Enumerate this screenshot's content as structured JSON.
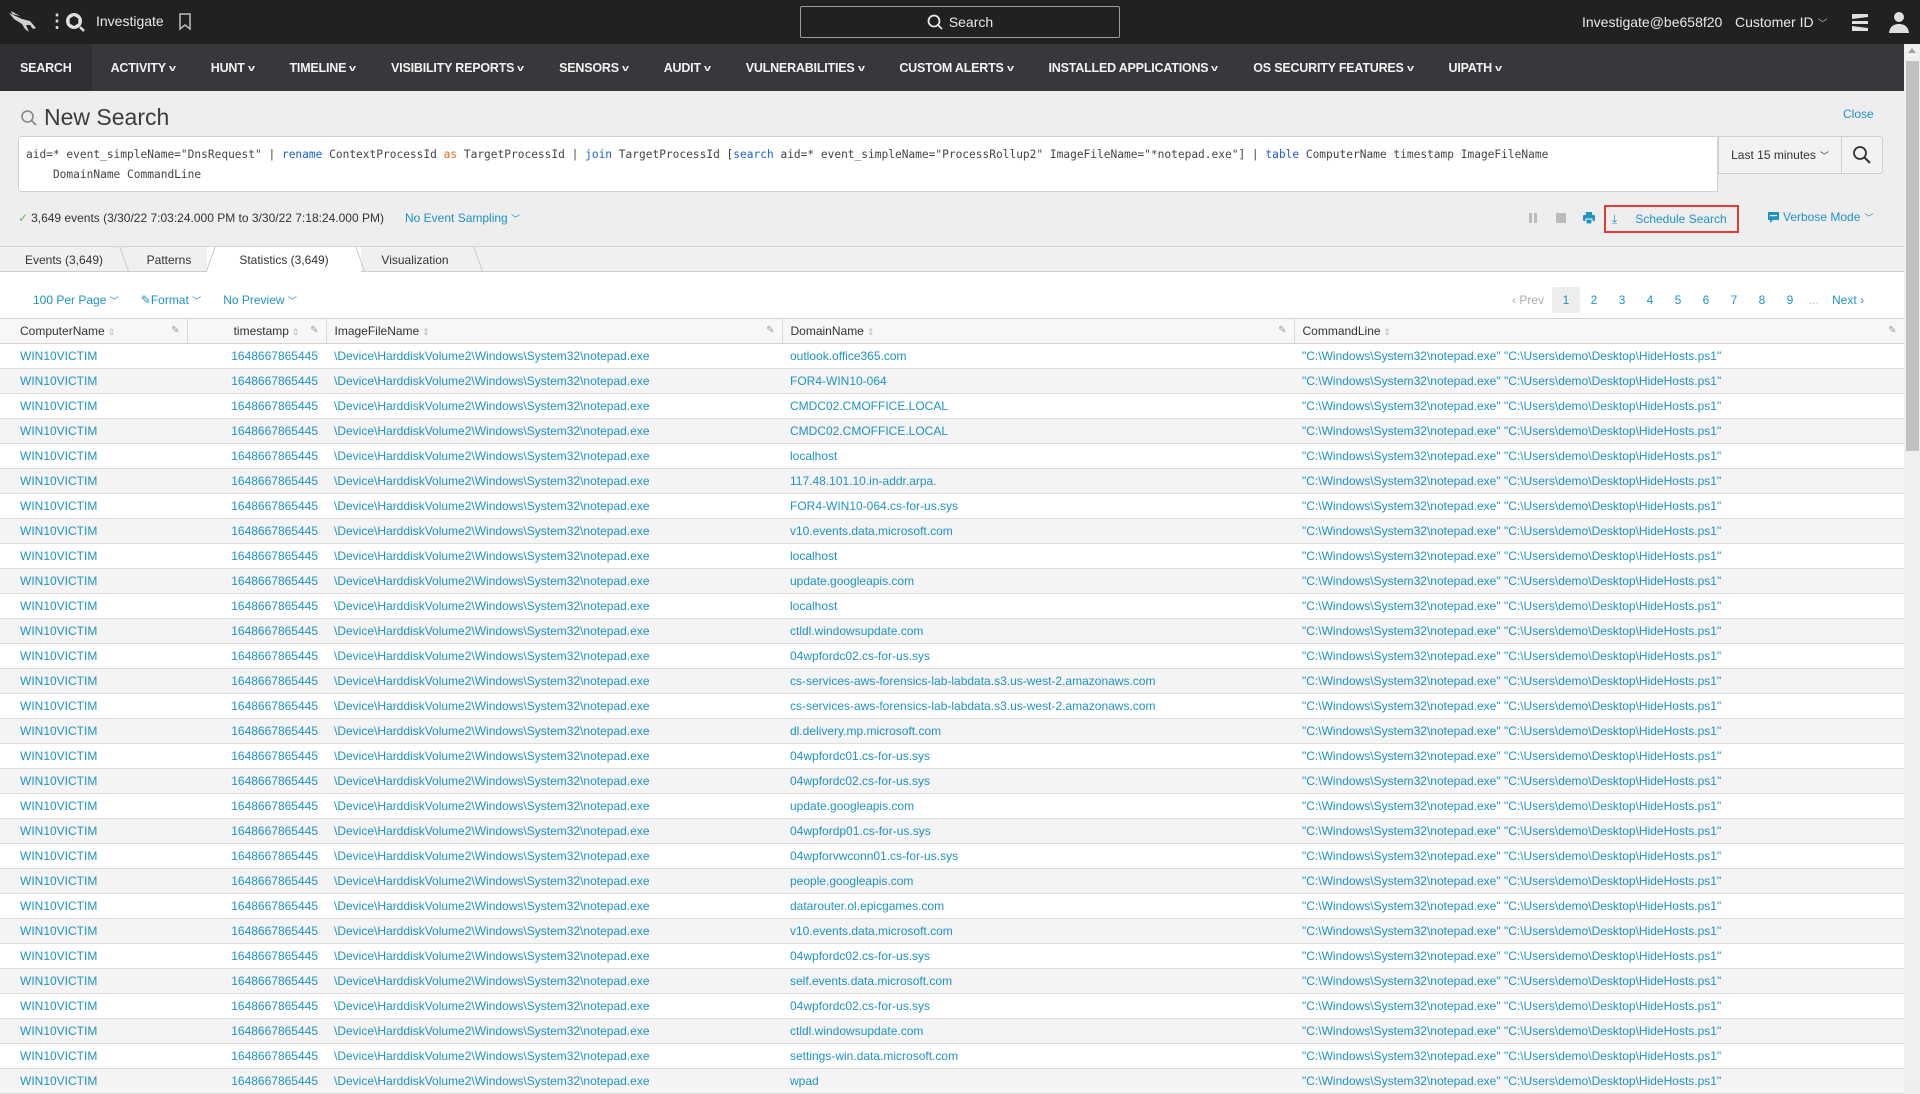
{
  "topbar": {
    "app_title": "Investigate",
    "global_search_label": "Search",
    "user_label": "Investigate@be658f20",
    "customer_id_label": "Customer ID"
  },
  "nav": {
    "items": [
      {
        "label": "SEARCH",
        "dropdown": false,
        "active": true
      },
      {
        "label": "ACTIVITY",
        "dropdown": true
      },
      {
        "label": "HUNT",
        "dropdown": true
      },
      {
        "label": "TIMELINE",
        "dropdown": true
      },
      {
        "label": "VISIBILITY REPORTS",
        "dropdown": true
      },
      {
        "label": "SENSORS",
        "dropdown": true
      },
      {
        "label": "AUDIT",
        "dropdown": true
      },
      {
        "label": "VULNERABILITIES",
        "dropdown": true
      },
      {
        "label": "CUSTOM ALERTS",
        "dropdown": true
      },
      {
        "label": "INSTALLED APPLICATIONS",
        "dropdown": true
      },
      {
        "label": "OS SECURITY FEATURES",
        "dropdown": true
      },
      {
        "label": "UIPATH",
        "dropdown": true
      }
    ]
  },
  "search": {
    "page_title": "New Search",
    "close_label": "Close",
    "query_line1_parts": [
      {
        "t": "aid=* event_simpleName=\"DnsRequest\" | ",
        "c": ""
      },
      {
        "t": "rename",
        "c": "blue"
      },
      {
        "t": " ContextProcessId ",
        "c": ""
      },
      {
        "t": "as",
        "c": "orange"
      },
      {
        "t": " TargetProcessId | ",
        "c": ""
      },
      {
        "t": "join",
        "c": "blue"
      },
      {
        "t": " TargetProcessId [",
        "c": ""
      },
      {
        "t": "search",
        "c": "blue"
      },
      {
        "t": " aid=* event_simpleName=\"ProcessRollup2\" ImageFileName=\"*notepad.exe\"] | ",
        "c": ""
      },
      {
        "t": "table",
        "c": "blue"
      },
      {
        "t": " ComputerName timestamp ImageFileName",
        "c": ""
      }
    ],
    "query_line2": "    DomainName CommandLine",
    "time_range": "Last 15 minutes"
  },
  "status": {
    "check": "✓",
    "summary": "3,649 events (3/30/22 7:03:24.000 PM to 3/30/22 7:18:24.000 PM)",
    "sampling": "No Event Sampling",
    "schedule_search": "Schedule Search",
    "mode": "Verbose Mode"
  },
  "tabs": [
    {
      "label": "Events (3,649)",
      "active": false
    },
    {
      "label": "Patterns",
      "active": false
    },
    {
      "label": "Statistics (3,649)",
      "active": true
    },
    {
      "label": "Visualization",
      "active": false
    }
  ],
  "table_controls": {
    "per_page": "100 Per Page",
    "format": "Format",
    "preview": "No Preview"
  },
  "pagination": {
    "prev": "‹ Prev",
    "pages": [
      "1",
      "2",
      "3",
      "4",
      "5",
      "6",
      "7",
      "8",
      "9"
    ],
    "current": "1",
    "ellipsis": "...",
    "next": "Next ›"
  },
  "table": {
    "columns": [
      "ComputerName",
      "timestamp",
      "ImageFileName",
      "DomainName",
      "CommandLine"
    ],
    "rows": [
      [
        "WIN10VICTIM",
        "1648667865445",
        "\\Device\\HarddiskVolume2\\Windows\\System32\\notepad.exe",
        "outlook.office365.com",
        "\"C:\\Windows\\System32\\notepad.exe\" \"C:\\Users\\demo\\Desktop\\HideHosts.ps1\""
      ],
      [
        "WIN10VICTIM",
        "1648667865445",
        "\\Device\\HarddiskVolume2\\Windows\\System32\\notepad.exe",
        "FOR4-WIN10-064",
        "\"C:\\Windows\\System32\\notepad.exe\" \"C:\\Users\\demo\\Desktop\\HideHosts.ps1\""
      ],
      [
        "WIN10VICTIM",
        "1648667865445",
        "\\Device\\HarddiskVolume2\\Windows\\System32\\notepad.exe",
        "CMDC02.CMOFFICE.LOCAL",
        "\"C:\\Windows\\System32\\notepad.exe\" \"C:\\Users\\demo\\Desktop\\HideHosts.ps1\""
      ],
      [
        "WIN10VICTIM",
        "1648667865445",
        "\\Device\\HarddiskVolume2\\Windows\\System32\\notepad.exe",
        "CMDC02.CMOFFICE.LOCAL",
        "\"C:\\Windows\\System32\\notepad.exe\" \"C:\\Users\\demo\\Desktop\\HideHosts.ps1\""
      ],
      [
        "WIN10VICTIM",
        "1648667865445",
        "\\Device\\HarddiskVolume2\\Windows\\System32\\notepad.exe",
        "localhost",
        "\"C:\\Windows\\System32\\notepad.exe\" \"C:\\Users\\demo\\Desktop\\HideHosts.ps1\""
      ],
      [
        "WIN10VICTIM",
        "1648667865445",
        "\\Device\\HarddiskVolume2\\Windows\\System32\\notepad.exe",
        "117.48.101.10.in-addr.arpa.",
        "\"C:\\Windows\\System32\\notepad.exe\" \"C:\\Users\\demo\\Desktop\\HideHosts.ps1\""
      ],
      [
        "WIN10VICTIM",
        "1648667865445",
        "\\Device\\HarddiskVolume2\\Windows\\System32\\notepad.exe",
        "FOR4-WIN10-064.cs-for-us.sys",
        "\"C:\\Windows\\System32\\notepad.exe\" \"C:\\Users\\demo\\Desktop\\HideHosts.ps1\""
      ],
      [
        "WIN10VICTIM",
        "1648667865445",
        "\\Device\\HarddiskVolume2\\Windows\\System32\\notepad.exe",
        "v10.events.data.microsoft.com",
        "\"C:\\Windows\\System32\\notepad.exe\" \"C:\\Users\\demo\\Desktop\\HideHosts.ps1\""
      ],
      [
        "WIN10VICTIM",
        "1648667865445",
        "\\Device\\HarddiskVolume2\\Windows\\System32\\notepad.exe",
        "localhost",
        "\"C:\\Windows\\System32\\notepad.exe\" \"C:\\Users\\demo\\Desktop\\HideHosts.ps1\""
      ],
      [
        "WIN10VICTIM",
        "1648667865445",
        "\\Device\\HarddiskVolume2\\Windows\\System32\\notepad.exe",
        "update.googleapis.com",
        "\"C:\\Windows\\System32\\notepad.exe\" \"C:\\Users\\demo\\Desktop\\HideHosts.ps1\""
      ],
      [
        "WIN10VICTIM",
        "1648667865445",
        "\\Device\\HarddiskVolume2\\Windows\\System32\\notepad.exe",
        "localhost",
        "\"C:\\Windows\\System32\\notepad.exe\" \"C:\\Users\\demo\\Desktop\\HideHosts.ps1\""
      ],
      [
        "WIN10VICTIM",
        "1648667865445",
        "\\Device\\HarddiskVolume2\\Windows\\System32\\notepad.exe",
        "ctldl.windowsupdate.com",
        "\"C:\\Windows\\System32\\notepad.exe\" \"C:\\Users\\demo\\Desktop\\HideHosts.ps1\""
      ],
      [
        "WIN10VICTIM",
        "1648667865445",
        "\\Device\\HarddiskVolume2\\Windows\\System32\\notepad.exe",
        "04wpfordc02.cs-for-us.sys",
        "\"C:\\Windows\\System32\\notepad.exe\" \"C:\\Users\\demo\\Desktop\\HideHosts.ps1\""
      ],
      [
        "WIN10VICTIM",
        "1648667865445",
        "\\Device\\HarddiskVolume2\\Windows\\System32\\notepad.exe",
        "cs-services-aws-forensics-lab-labdata.s3.us-west-2.amazonaws.com",
        "\"C:\\Windows\\System32\\notepad.exe\" \"C:\\Users\\demo\\Desktop\\HideHosts.ps1\""
      ],
      [
        "WIN10VICTIM",
        "1648667865445",
        "\\Device\\HarddiskVolume2\\Windows\\System32\\notepad.exe",
        "cs-services-aws-forensics-lab-labdata.s3.us-west-2.amazonaws.com",
        "\"C:\\Windows\\System32\\notepad.exe\" \"C:\\Users\\demo\\Desktop\\HideHosts.ps1\""
      ],
      [
        "WIN10VICTIM",
        "1648667865445",
        "\\Device\\HarddiskVolume2\\Windows\\System32\\notepad.exe",
        "dl.delivery.mp.microsoft.com",
        "\"C:\\Windows\\System32\\notepad.exe\" \"C:\\Users\\demo\\Desktop\\HideHosts.ps1\""
      ],
      [
        "WIN10VICTIM",
        "1648667865445",
        "\\Device\\HarddiskVolume2\\Windows\\System32\\notepad.exe",
        "04wpfordc01.cs-for-us.sys",
        "\"C:\\Windows\\System32\\notepad.exe\" \"C:\\Users\\demo\\Desktop\\HideHosts.ps1\""
      ],
      [
        "WIN10VICTIM",
        "1648667865445",
        "\\Device\\HarddiskVolume2\\Windows\\System32\\notepad.exe",
        "04wpfordc02.cs-for-us.sys",
        "\"C:\\Windows\\System32\\notepad.exe\" \"C:\\Users\\demo\\Desktop\\HideHosts.ps1\""
      ],
      [
        "WIN10VICTIM",
        "1648667865445",
        "\\Device\\HarddiskVolume2\\Windows\\System32\\notepad.exe",
        "update.googleapis.com",
        "\"C:\\Windows\\System32\\notepad.exe\" \"C:\\Users\\demo\\Desktop\\HideHosts.ps1\""
      ],
      [
        "WIN10VICTIM",
        "1648667865445",
        "\\Device\\HarddiskVolume2\\Windows\\System32\\notepad.exe",
        "04wpfordp01.cs-for-us.sys",
        "\"C:\\Windows\\System32\\notepad.exe\" \"C:\\Users\\demo\\Desktop\\HideHosts.ps1\""
      ],
      [
        "WIN10VICTIM",
        "1648667865445",
        "\\Device\\HarddiskVolume2\\Windows\\System32\\notepad.exe",
        "04wpforvwconn01.cs-for-us.sys",
        "\"C:\\Windows\\System32\\notepad.exe\" \"C:\\Users\\demo\\Desktop\\HideHosts.ps1\""
      ],
      [
        "WIN10VICTIM",
        "1648667865445",
        "\\Device\\HarddiskVolume2\\Windows\\System32\\notepad.exe",
        "people.googleapis.com",
        "\"C:\\Windows\\System32\\notepad.exe\" \"C:\\Users\\demo\\Desktop\\HideHosts.ps1\""
      ],
      [
        "WIN10VICTIM",
        "1648667865445",
        "\\Device\\HarddiskVolume2\\Windows\\System32\\notepad.exe",
        "datarouter.ol.epicgames.com",
        "\"C:\\Windows\\System32\\notepad.exe\" \"C:\\Users\\demo\\Desktop\\HideHosts.ps1\""
      ],
      [
        "WIN10VICTIM",
        "1648667865445",
        "\\Device\\HarddiskVolume2\\Windows\\System32\\notepad.exe",
        "v10.events.data.microsoft.com",
        "\"C:\\Windows\\System32\\notepad.exe\" \"C:\\Users\\demo\\Desktop\\HideHosts.ps1\""
      ],
      [
        "WIN10VICTIM",
        "1648667865445",
        "\\Device\\HarddiskVolume2\\Windows\\System32\\notepad.exe",
        "04wpfordc02.cs-for-us.sys",
        "\"C:\\Windows\\System32\\notepad.exe\" \"C:\\Users\\demo\\Desktop\\HideHosts.ps1\""
      ],
      [
        "WIN10VICTIM",
        "1648667865445",
        "\\Device\\HarddiskVolume2\\Windows\\System32\\notepad.exe",
        "self.events.data.microsoft.com",
        "\"C:\\Windows\\System32\\notepad.exe\" \"C:\\Users\\demo\\Desktop\\HideHosts.ps1\""
      ],
      [
        "WIN10VICTIM",
        "1648667865445",
        "\\Device\\HarddiskVolume2\\Windows\\System32\\notepad.exe",
        "04wpfordc02.cs-for-us.sys",
        "\"C:\\Windows\\System32\\notepad.exe\" \"C:\\Users\\demo\\Desktop\\HideHosts.ps1\""
      ],
      [
        "WIN10VICTIM",
        "1648667865445",
        "\\Device\\HarddiskVolume2\\Windows\\System32\\notepad.exe",
        "ctldl.windowsupdate.com",
        "\"C:\\Windows\\System32\\notepad.exe\" \"C:\\Users\\demo\\Desktop\\HideHosts.ps1\""
      ],
      [
        "WIN10VICTIM",
        "1648667865445",
        "\\Device\\HarddiskVolume2\\Windows\\System32\\notepad.exe",
        "settings-win.data.microsoft.com",
        "\"C:\\Windows\\System32\\notepad.exe\" \"C:\\Users\\demo\\Desktop\\HideHosts.ps1\""
      ],
      [
        "WIN10VICTIM",
        "1648667865445",
        "\\Device\\HarddiskVolume2\\Windows\\System32\\notepad.exe",
        "wpad",
        "\"C:\\Windows\\System32\\notepad.exe\" \"C:\\Users\\demo\\Desktop\\HideHosts.ps1\""
      ]
    ]
  },
  "colors": {
    "link": "#1e93c6",
    "topbar": "#212121",
    "navbar": "#36383c",
    "highlight_box": "#e53935"
  }
}
